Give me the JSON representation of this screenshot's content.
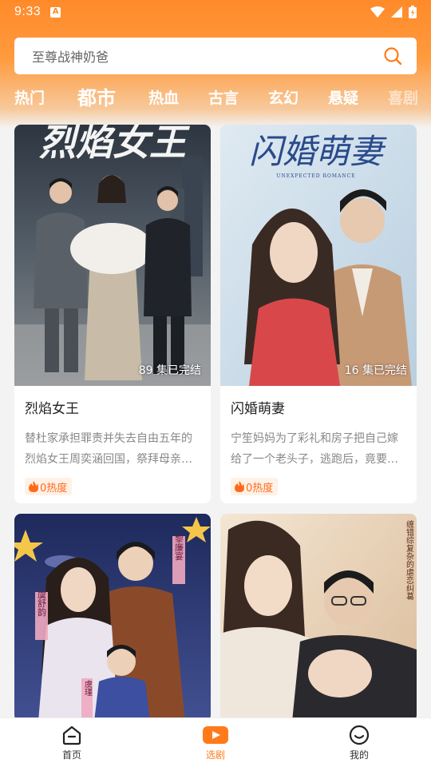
{
  "status_bar": {
    "time": "9:33"
  },
  "search": {
    "placeholder": "至尊战神奶爸"
  },
  "tabs": [
    {
      "label": "热门",
      "active": false
    },
    {
      "label": "都市",
      "active": true
    },
    {
      "label": "热血",
      "active": false
    },
    {
      "label": "古言",
      "active": false
    },
    {
      "label": "玄幻",
      "active": false
    },
    {
      "label": "悬疑",
      "active": false
    },
    {
      "label": "喜剧",
      "active": false
    }
  ],
  "cards": [
    {
      "title": "烈焰女王",
      "episodes": "89 集已完结",
      "description": "替杜家承担罪责并失去自由五年的烈焰女王周奕涵回国，祭拜母亲…",
      "heat": "0热度",
      "poster_title": "烈焰女王"
    },
    {
      "title": "闪婚萌妻",
      "episodes": "16 集已完结",
      "description": "宁笙妈妈为了彩礼和房子把自己嫁给了一个老头子，逃跑后，竟要…",
      "heat": "0热度",
      "poster_title": "闪婚萌妻",
      "poster_subtitle": "UNEXPECTED ROMANCE"
    },
    {
      "title": "",
      "poster_names": [
        "黎廉宴",
        "虞舒韵",
        "虞瑾"
      ]
    },
    {
      "title": "",
      "poster_tagline": "缠错综复杂的虐恋纠葛"
    }
  ],
  "bottom_nav": [
    {
      "label": "首页",
      "icon": "home-icon",
      "active": false
    },
    {
      "label": "选剧",
      "icon": "play-icon",
      "active": true
    },
    {
      "label": "我的",
      "icon": "smile-icon",
      "active": false
    }
  ],
  "colors": {
    "accent": "#ff7a1a",
    "header_orange": "#ff8a2a"
  }
}
